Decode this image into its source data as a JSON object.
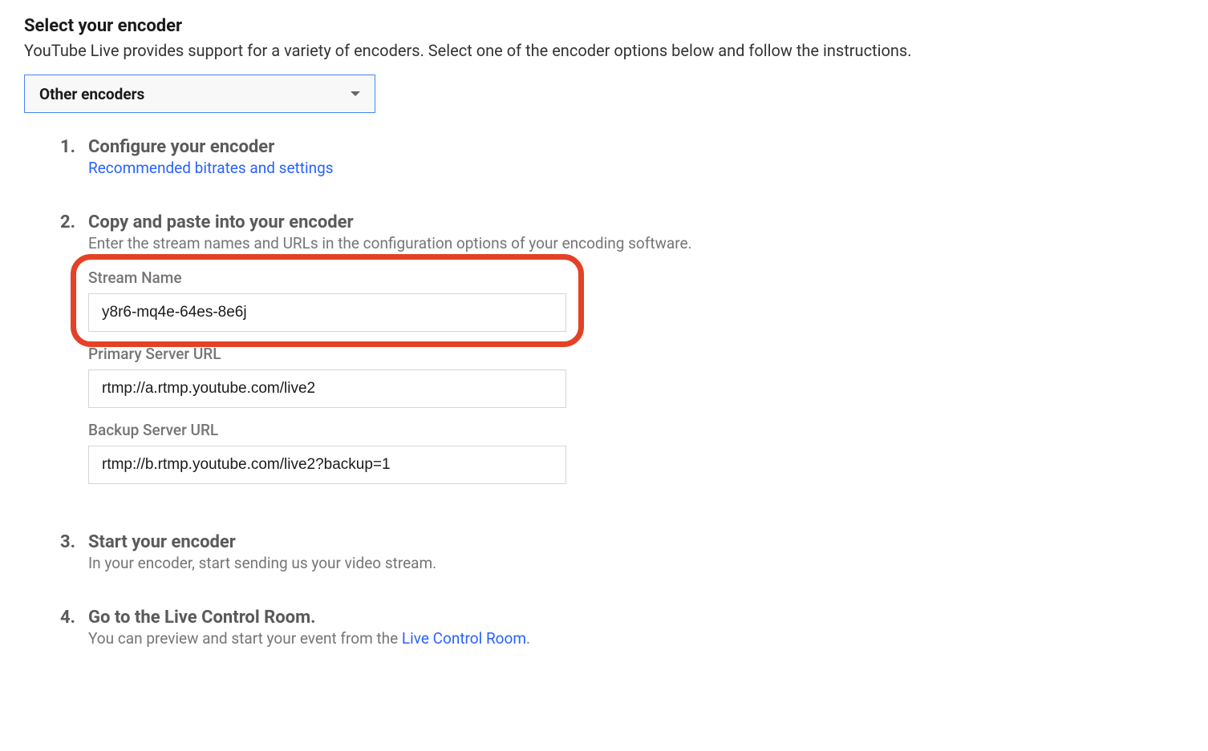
{
  "header": {
    "title": "Select your encoder",
    "subtitle": "YouTube Live provides support for a variety of encoders. Select one of the encoder options below and follow the instructions."
  },
  "dropdown": {
    "selected": "Other encoders"
  },
  "steps": [
    {
      "number": "1.",
      "title": "Configure your encoder",
      "link": "Recommended bitrates and settings"
    },
    {
      "number": "2.",
      "title": "Copy and paste into your encoder",
      "desc": "Enter the stream names and URLs in the configuration options of your encoding software.",
      "fields": {
        "stream_name": {
          "label": "Stream Name",
          "value": "y8r6-mq4e-64es-8e6j"
        },
        "primary_url": {
          "label": "Primary Server URL",
          "value": "rtmp://a.rtmp.youtube.com/live2"
        },
        "backup_url": {
          "label": "Backup Server URL",
          "value": "rtmp://b.rtmp.youtube.com/live2?backup=1"
        }
      }
    },
    {
      "number": "3.",
      "title": "Start your encoder",
      "desc": "In your encoder, start sending us your video stream."
    },
    {
      "number": "4.",
      "title": "Go to the Live Control Room.",
      "desc_prefix": "You can preview and start your event from the ",
      "inline_link": "Live Control Room",
      "desc_suffix": "."
    }
  ]
}
